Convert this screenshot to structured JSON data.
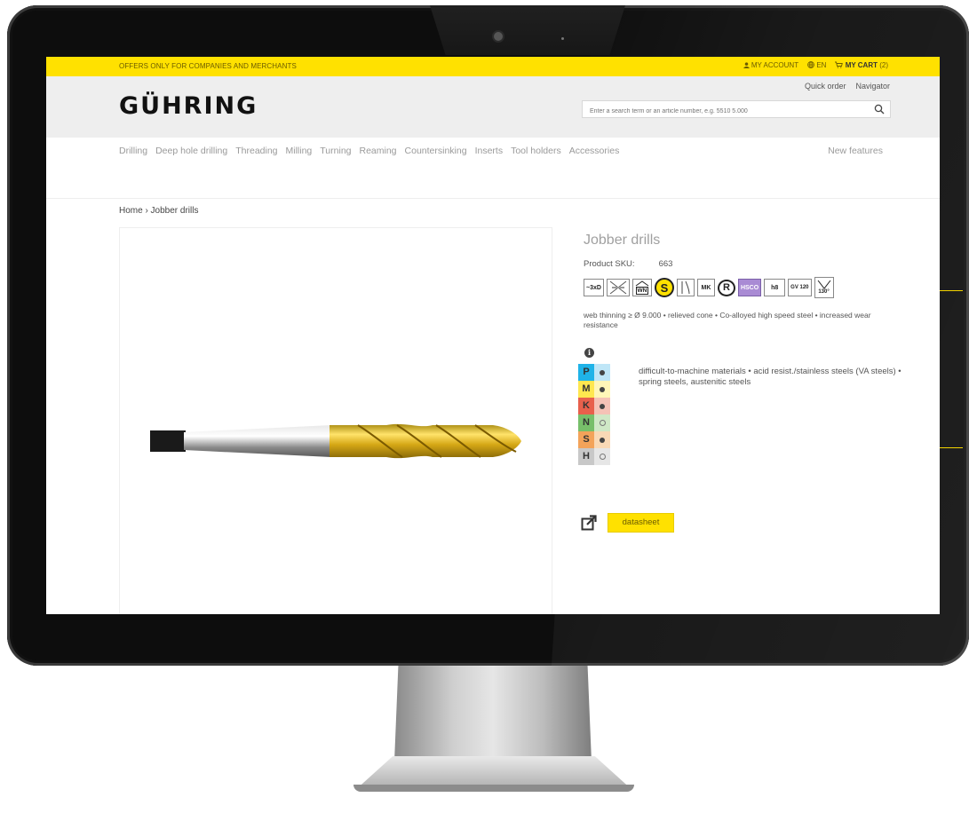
{
  "topbar": {
    "offers": "OFFERS ONLY FOR COMPANIES AND MERCHANTS",
    "account": "MY ACCOUNT",
    "language": "EN",
    "cart_label": "MY CART",
    "cart_count": "(2)"
  },
  "header": {
    "logo": "GÜHRING",
    "quick_order": "Quick order",
    "navigator": "Navigator",
    "search_placeholder": "Enter a search term or an article number, e.g. 5510 5.000"
  },
  "nav": {
    "items": [
      "Drilling",
      "Deep hole drilling",
      "Threading",
      "Milling",
      "Turning",
      "Reaming",
      "Countersinking",
      "Inserts",
      "Tool holders",
      "Accessories"
    ],
    "new_features": "New features"
  },
  "breadcrumb": "Home › Jobber drills",
  "product": {
    "title": "Jobber drills",
    "sku_label": "Product SKU:",
    "sku_value": "663",
    "property_icons": [
      "~3xD",
      "",
      "WN",
      "S",
      "",
      "MK",
      "R",
      "HSCO",
      "h8",
      "GV 120",
      "130°"
    ],
    "features": "web thinning ≥ Ø 9.000 • relieved cone • Co-alloyed high speed steel • increased wear resistance",
    "material_description": "difficult-to-machine materials • acid resist./stainless steels (VA steels) • spring steels, austenitic steels",
    "datasheet_label": "datasheet"
  },
  "materials": [
    {
      "letter": "P",
      "color": "#1fb3e8",
      "light": "#bfe6f7",
      "suitable": "full"
    },
    {
      "letter": "M",
      "color": "#ffe74f",
      "light": "#fff6b8",
      "suitable": "full"
    },
    {
      "letter": "K",
      "color": "#e8604c",
      "light": "#f5c2b6",
      "suitable": "full"
    },
    {
      "letter": "N",
      "color": "#77bf6a",
      "light": "#cfe8c6",
      "suitable": "empty"
    },
    {
      "letter": "S",
      "color": "#f3a35a",
      "light": "#f9d9b6",
      "suitable": "full"
    },
    {
      "letter": "H",
      "color": "#c8c8c8",
      "light": "#e6e6e6",
      "suitable": "empty"
    }
  ],
  "colors": {
    "accent": "#ffe100",
    "text_dark": "#333333",
    "text_light": "#9a9a9a"
  }
}
